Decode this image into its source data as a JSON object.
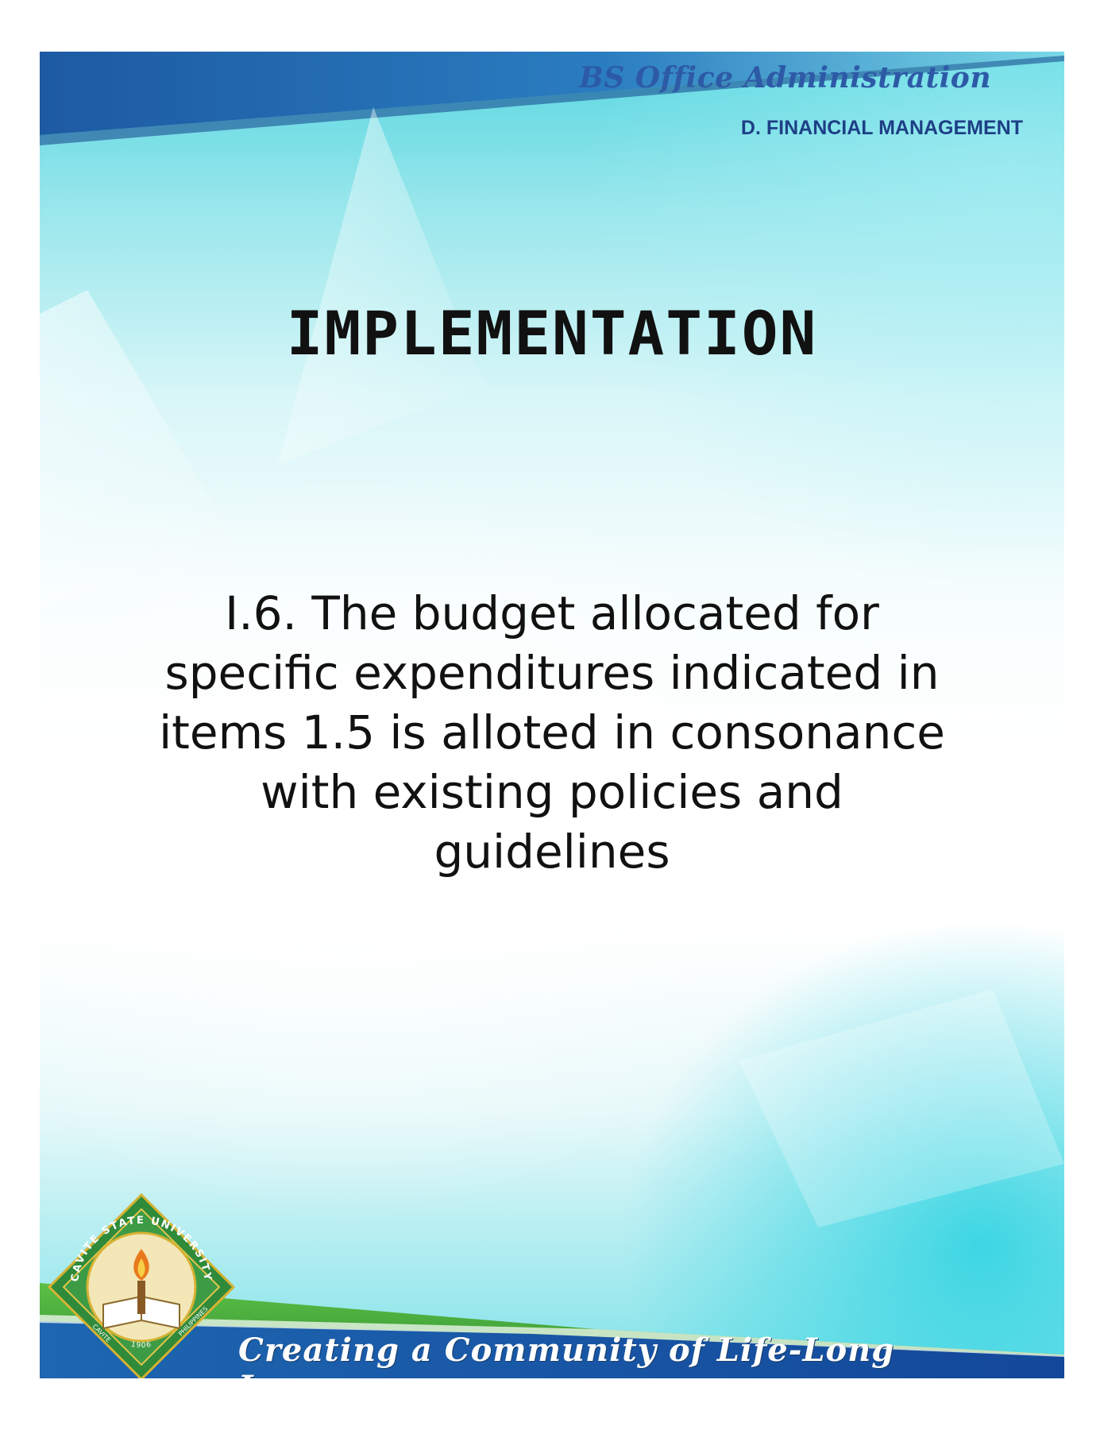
{
  "header": {
    "program": "BS Office Administration",
    "section": "D. FINANCIAL MANAGEMENT"
  },
  "main": {
    "heading": "IMPLEMENTATION",
    "lines": [
      "I.6. The budget allocated for",
      "specific expenditures indicated in",
      "items 1.5 is alloted in consonance",
      "with existing policies and",
      "guidelines"
    ]
  },
  "footer": {
    "tagline": "Creating a Community of Life-Long Learners",
    "seal": {
      "name": "CAVITE STATE UNIVERSITY",
      "year": "1906",
      "place_left": "CAVITE",
      "place_right": "PHILIPPINES"
    }
  },
  "colors": {
    "top_band": "#1f5fa8",
    "footer_blue": "#1c57a8",
    "footer_green": "#3fa53a",
    "heading_blue": "#2d5aa6"
  }
}
